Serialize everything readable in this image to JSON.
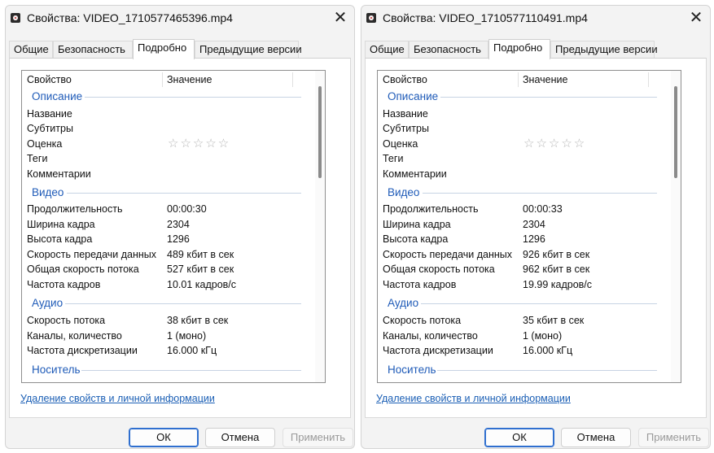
{
  "dialogs": [
    {
      "title": "Свойства: VIDEO_1710577465396.mp4",
      "tabs": [
        "Общие",
        "Безопасность",
        "Подробно",
        "Предыдущие версии"
      ],
      "active_tab": "Подробно",
      "header": {
        "property": "Свойство",
        "value": "Значение"
      },
      "groups": {
        "description": "Описание",
        "video": "Видео",
        "audio": "Аудио",
        "media": "Носитель"
      },
      "description": {
        "name": "Название",
        "subtitles": "Субтитры",
        "rating": "Оценка",
        "tags": "Теги",
        "comments": "Комментарии"
      },
      "rating_stars": "☆☆☆☆☆",
      "video": [
        {
          "label": "Продолжительность",
          "value": "00:00:30"
        },
        {
          "label": "Ширина кадра",
          "value": "2304"
        },
        {
          "label": "Высота кадра",
          "value": "1296"
        },
        {
          "label": "Скорость передачи данных",
          "value": "489 кбит в сек"
        },
        {
          "label": "Общая скорость потока",
          "value": "527 кбит в сек"
        },
        {
          "label": "Частота кадров",
          "value": "10.01 кадров/с"
        }
      ],
      "audio": [
        {
          "label": "Скорость потока",
          "value": "38 кбит в сек"
        },
        {
          "label": "Каналы, количество",
          "value": "1 (моно)"
        },
        {
          "label": "Частота дискретизации",
          "value": "16.000 кГц"
        }
      ],
      "remove_link": "Удаление свойств и личной информации",
      "buttons": {
        "ok": "ОК",
        "cancel": "Отмена",
        "apply": "Применить"
      }
    },
    {
      "title": "Свойства: VIDEO_1710577110491.mp4",
      "tabs": [
        "Общие",
        "Безопасность",
        "Подробно",
        "Предыдущие версии"
      ],
      "active_tab": "Подробно",
      "header": {
        "property": "Свойство",
        "value": "Значение"
      },
      "groups": {
        "description": "Описание",
        "video": "Видео",
        "audio": "Аудио",
        "media": "Носитель"
      },
      "description": {
        "name": "Название",
        "subtitles": "Субтитры",
        "rating": "Оценка",
        "tags": "Теги",
        "comments": "Комментарии"
      },
      "rating_stars": "☆☆☆☆☆",
      "video": [
        {
          "label": "Продолжительность",
          "value": "00:00:33"
        },
        {
          "label": "Ширина кадра",
          "value": "2304"
        },
        {
          "label": "Высота кадра",
          "value": "1296"
        },
        {
          "label": "Скорость передачи данных",
          "value": "926 кбит в сек"
        },
        {
          "label": "Общая скорость потока",
          "value": "962 кбит в сек"
        },
        {
          "label": "Частота кадров",
          "value": "19.99 кадров/с"
        }
      ],
      "audio": [
        {
          "label": "Скорость потока",
          "value": "35 кбит в сек"
        },
        {
          "label": "Каналы, количество",
          "value": "1 (моно)"
        },
        {
          "label": "Частота дискретизации",
          "value": "16.000 кГц"
        }
      ],
      "remove_link": "Удаление свойств и личной информации",
      "buttons": {
        "ok": "ОК",
        "cancel": "Отмена",
        "apply": "Применить"
      }
    }
  ],
  "colors": {
    "group_heading": "#1f5bb8",
    "link": "#1b5fb5",
    "ok_border": "#2f6fcf",
    "disabled_text": "#9a9a9a"
  },
  "icons": {
    "app": "media-file-icon",
    "close": "close-icon",
    "rating": "star-outline-icon"
  }
}
